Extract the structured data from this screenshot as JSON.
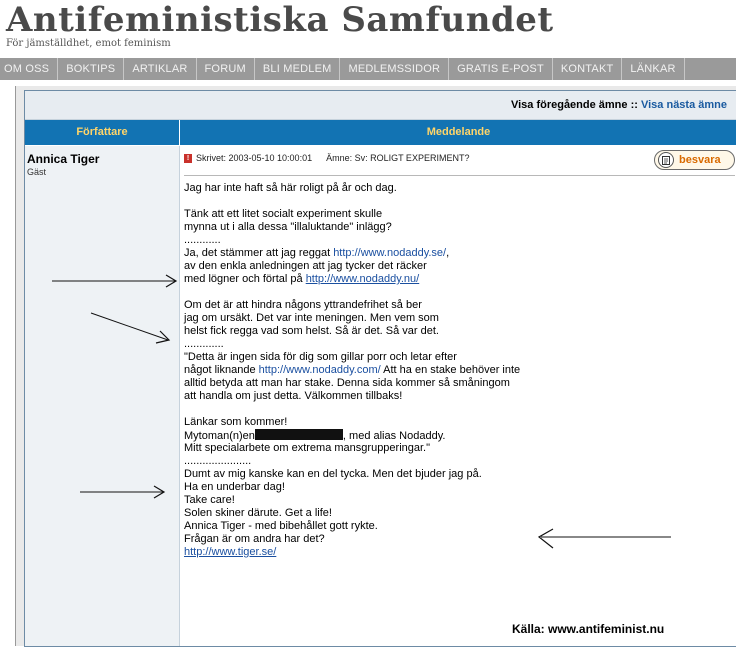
{
  "site": {
    "title": "Antifeministiska Samfundet",
    "tagline": "För jämställdhet, emot feminism"
  },
  "nav": {
    "items": [
      "OM OSS",
      "BOKTIPS",
      "ARTIKLAR",
      "FORUM",
      "BLI MEDLEM",
      "MEDLEMSSIDOR",
      "GRATIS E-POST",
      "KONTAKT",
      "LÄNKAR"
    ]
  },
  "topic_nav": {
    "prev": "Visa föregående ämne",
    "separator": "::",
    "next": "Visa nästa ämne"
  },
  "table_header": {
    "author": "Författare",
    "message": "Meddelande"
  },
  "post": {
    "author": "Annica Tiger",
    "rank": "Gäst",
    "posted": "Skrivet: 2003-05-10 10:00:01",
    "subject": "Ämne: Sv: ROLIGT EXPERIMENT?",
    "quote_label": "besvara",
    "body": {
      "l1": "Jag har inte haft så här roligt på år och dag.",
      "l2": "Tänk att ett litet socialt experiment skulle",
      "l3": "mynna ut i alla dessa \"illaluktande\" inlägg?",
      "l4": "............",
      "l5a": "Ja, det stämmer att jag reggat ",
      "l5b": "http://www.nodaddy.se/",
      "l5c": ",",
      "l6": "av den enkla anledningen att jag tycker det räcker",
      "l7a": "med lögner och förtal på ",
      "l7b": "http://www.nodaddy.nu/",
      "l8": "Om det är att hindra någons yttrandefrihet så ber",
      "l9": "jag om ursäkt. Det var inte meningen. Men vem som",
      "l10": "helst fick regga vad som helst. Så är det. Så var det.",
      "l11": ".............",
      "l12": "\"Detta är ingen sida för dig som gillar porr och letar efter",
      "l13a": "något liknande ",
      "l13b": "http://www.nodaddy.com/",
      "l13c": " Att ha en stake behöver inte",
      "l14": "alltid betyda att man har stake. Denna sida kommer så småningom",
      "l15": "att handla om just detta. Välkommen tillbaks!",
      "l16": "Länkar som kommer!",
      "l17a": "Mytoman(n)en",
      "l17b": ", med alias Nodaddy.",
      "l18": "Mitt specialarbete om extrema mansgrupperingar.\"",
      "l19": "......................",
      "l20": "Dumt av mig kanske kan en del tycka. Men det bjuder jag på.",
      "l21": "Ha en underbar dag!",
      "l22": "Take care!",
      "l23": "Solen skiner därute. Get a life!",
      "l24": "Annica Tiger - med bibehållet gott rykte.",
      "l25": "Frågan är om andra har det?",
      "l26": "http://www.tiger.se/"
    }
  },
  "source_credit": "Källa: www.antifeminist.nu",
  "colors": {
    "header_bar": "#1273b3",
    "header_text": "#ffd56a",
    "link": "#1a4fa0",
    "nav_bar": "#9a9a9a"
  }
}
